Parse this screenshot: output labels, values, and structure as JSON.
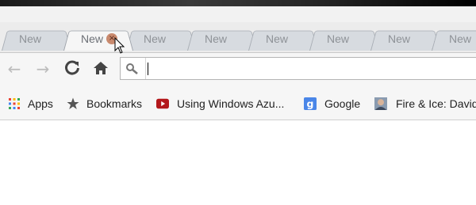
{
  "tabs": [
    {
      "label": "New",
      "active": false
    },
    {
      "label": "New",
      "active": true
    },
    {
      "label": "New",
      "active": false
    },
    {
      "label": "New",
      "active": false
    },
    {
      "label": "New",
      "active": false
    },
    {
      "label": "New",
      "active": false
    },
    {
      "label": "New",
      "active": false
    },
    {
      "label": "New",
      "active": false
    }
  ],
  "tab_close_glyph": "×",
  "toolbar": {
    "back_icon": "←",
    "forward_icon": "→",
    "reload_icon": "C",
    "home_icon": "⌂",
    "omnibox_value": ""
  },
  "bookmarks": [
    {
      "label": "Apps",
      "icon": "apps-grid-icon"
    },
    {
      "label": "Bookmarks",
      "icon": "star-icon"
    },
    {
      "label": "Using Windows Azu...",
      "icon": "youtube-icon"
    },
    {
      "label": "Google",
      "icon": "google-icon"
    },
    {
      "label": "Fire & Ice: David",
      "icon": "avatar-icon"
    }
  ],
  "colors": {
    "youtube": "#b3181b",
    "google": "#4a86e8",
    "apps": [
      "#e94235",
      "#fbbc04",
      "#34a853",
      "#4285f4"
    ]
  }
}
